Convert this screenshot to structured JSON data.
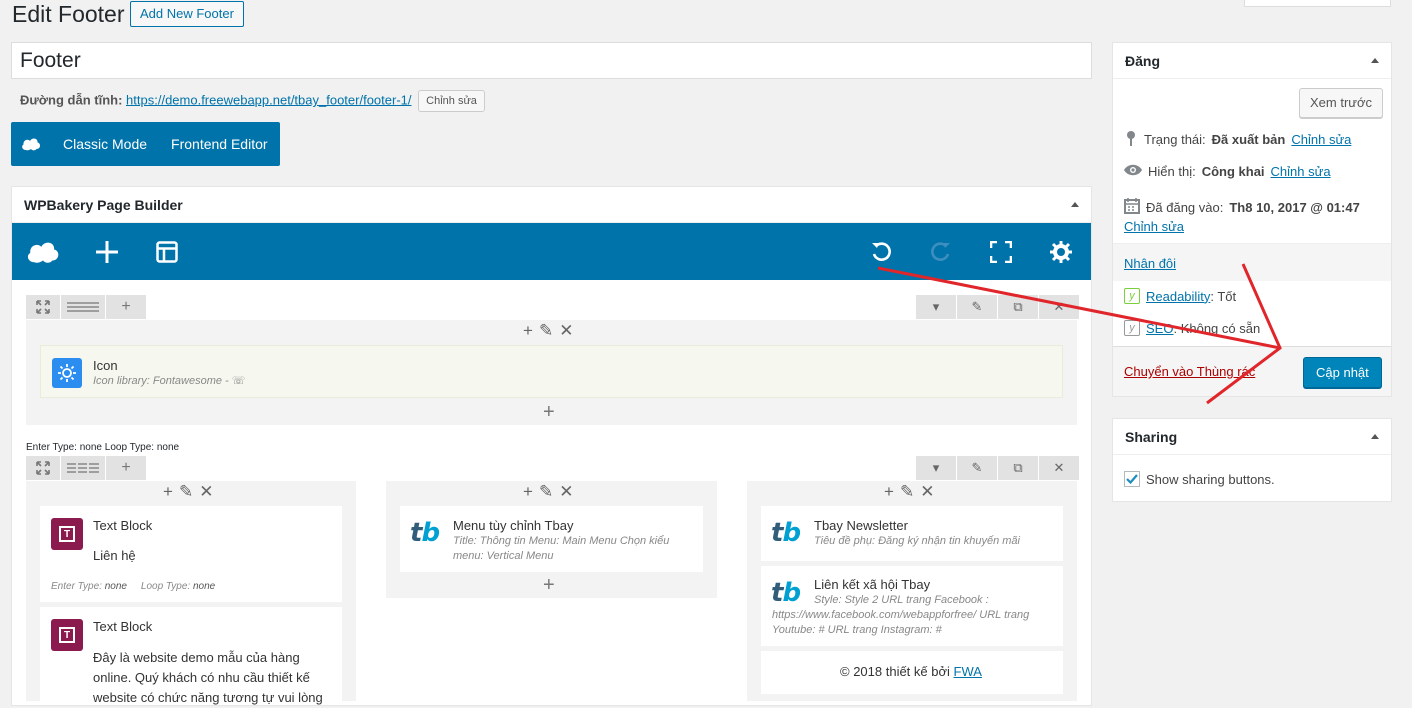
{
  "header": {
    "title": "Edit Footer",
    "add_new_label": "Add New Footer"
  },
  "post": {
    "title_value": "Footer",
    "permalink_label": "Đường dẫn tĩnh:",
    "permalink_url": "https://demo.freewebapp.net/tbay_footer/footer-1/",
    "permalink_edit_label": "Chỉnh sửa"
  },
  "mode_bar": {
    "classic_label": "Classic Mode",
    "frontend_label": "Frontend Editor"
  },
  "builder": {
    "title": "WPBakery Page Builder",
    "toolbar_icons": [
      "cloud-icon",
      "add-element-icon",
      "templates-icon",
      "undo-icon",
      "redo-icon",
      "fullscreen-icon",
      "settings-icon"
    ],
    "row1": {
      "element": {
        "title": "Icon",
        "subtitle": "Icon library: Fontawesome - ☏"
      },
      "row_meta": "Enter Type: none  Loop Type: none"
    },
    "row2": {
      "col1": [
        {
          "title": "Text Block",
          "body": "Liên hệ",
          "meta_enter": "Enter Type:",
          "meta_enter_val": "none",
          "meta_loop": "Loop Type:",
          "meta_loop_val": "none"
        },
        {
          "title": "Text Block",
          "body": "Đây là website demo mẫu của hàng online. Quý khách có nhu cầu thiết kế website có chức năng tương tự vui lòng"
        }
      ],
      "col2": [
        {
          "title": "Menu tùy chỉnh Tbay",
          "subtitle": "Title: Thông tin  Menu: Main Menu  Chọn kiểu menu: Vertical Menu"
        }
      ],
      "col3": [
        {
          "title": "Tbay Newsletter",
          "subtitle": "Tiêu đề phụ: Đăng ký nhận tin khuyến mãi"
        },
        {
          "title": "Liên kết xã hội Tbay",
          "subtitle": "Style: Style 2  URL trang Facebook : https://www.facebook.com/webappforfree/  URL trang Youtube: #  URL trang Instagram: #"
        },
        {
          "copyright_text": "© 2018 thiết kế bởi ",
          "copyright_link": "FWA"
        }
      ]
    }
  },
  "publish": {
    "title": "Đăng",
    "preview_label": "Xem trước",
    "status_label": "Trạng thái:",
    "status_value": "Đã xuất bản",
    "visibility_label": "Hiển thị:",
    "visibility_value": "Công khai",
    "published_label": "Đã đăng vào:",
    "published_value": "Th8 10, 2017 @ 01:47",
    "edit_link": "Chỉnh sửa",
    "duplicate_label": "Nhân đôi",
    "readability_label": "Readability",
    "readability_value": ": Tốt",
    "seo_label": "SEO",
    "seo_value": ": Không có sẵn",
    "trash_label": "Chuyển vào Thùng rác",
    "update_label": "Cập nhật"
  },
  "sharing": {
    "title": "Sharing",
    "checkbox_label": "Show sharing buttons."
  },
  "colors": {
    "accent": "#0073aa",
    "primary_button": "#0085ba",
    "arrow": "#e0262a",
    "text_block_icon": "#8b1a4f"
  }
}
